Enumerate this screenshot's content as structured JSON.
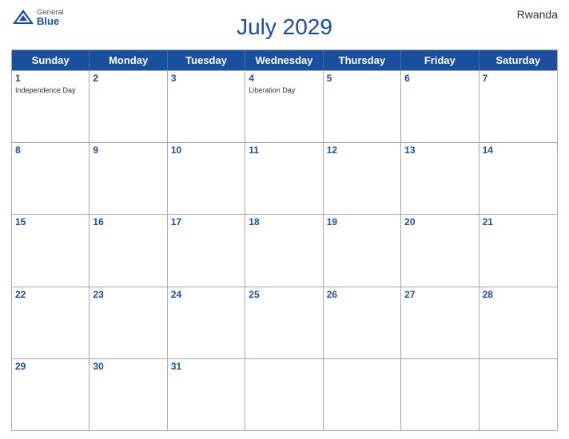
{
  "header": {
    "title": "July 2029",
    "country": "Rwanda",
    "logo": {
      "general": "General",
      "blue": "Blue"
    }
  },
  "calendar": {
    "days_of_week": [
      "Sunday",
      "Monday",
      "Tuesday",
      "Wednesday",
      "Thursday",
      "Friday",
      "Saturday"
    ],
    "weeks": [
      [
        {
          "day": "1",
          "holiday": "Independence Day"
        },
        {
          "day": "2",
          "holiday": ""
        },
        {
          "day": "3",
          "holiday": ""
        },
        {
          "day": "4",
          "holiday": "Liberation Day"
        },
        {
          "day": "5",
          "holiday": ""
        },
        {
          "day": "6",
          "holiday": ""
        },
        {
          "day": "7",
          "holiday": ""
        }
      ],
      [
        {
          "day": "8",
          "holiday": ""
        },
        {
          "day": "9",
          "holiday": ""
        },
        {
          "day": "10",
          "holiday": ""
        },
        {
          "day": "11",
          "holiday": ""
        },
        {
          "day": "12",
          "holiday": ""
        },
        {
          "day": "13",
          "holiday": ""
        },
        {
          "day": "14",
          "holiday": ""
        }
      ],
      [
        {
          "day": "15",
          "holiday": ""
        },
        {
          "day": "16",
          "holiday": ""
        },
        {
          "day": "17",
          "holiday": ""
        },
        {
          "day": "18",
          "holiday": ""
        },
        {
          "day": "19",
          "holiday": ""
        },
        {
          "day": "20",
          "holiday": ""
        },
        {
          "day": "21",
          "holiday": ""
        }
      ],
      [
        {
          "day": "22",
          "holiday": ""
        },
        {
          "day": "23",
          "holiday": ""
        },
        {
          "day": "24",
          "holiday": ""
        },
        {
          "day": "25",
          "holiday": ""
        },
        {
          "day": "26",
          "holiday": ""
        },
        {
          "day": "27",
          "holiday": ""
        },
        {
          "day": "28",
          "holiday": ""
        }
      ],
      [
        {
          "day": "29",
          "holiday": ""
        },
        {
          "day": "30",
          "holiday": ""
        },
        {
          "day": "31",
          "holiday": ""
        },
        {
          "day": "",
          "holiday": ""
        },
        {
          "day": "",
          "holiday": ""
        },
        {
          "day": "",
          "holiday": ""
        },
        {
          "day": "",
          "holiday": ""
        }
      ]
    ]
  }
}
